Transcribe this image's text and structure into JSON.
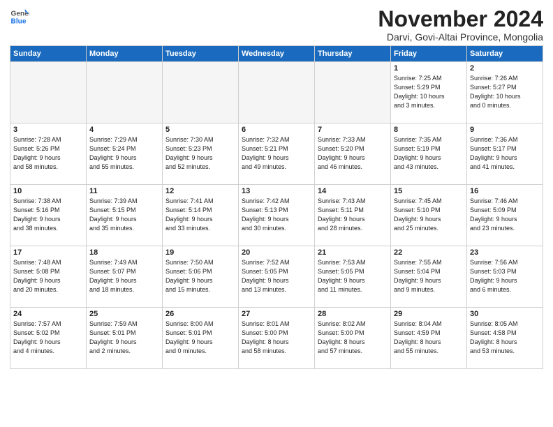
{
  "logo": {
    "line1": "General",
    "line2": "Blue"
  },
  "title": "November 2024",
  "subtitle": "Darvi, Govi-Altai Province, Mongolia",
  "weekdays": [
    "Sunday",
    "Monday",
    "Tuesday",
    "Wednesday",
    "Thursday",
    "Friday",
    "Saturday"
  ],
  "weeks": [
    [
      {
        "day": "",
        "info": "",
        "empty": true
      },
      {
        "day": "",
        "info": "",
        "empty": true
      },
      {
        "day": "",
        "info": "",
        "empty": true
      },
      {
        "day": "",
        "info": "",
        "empty": true
      },
      {
        "day": "",
        "info": "",
        "empty": true
      },
      {
        "day": "1",
        "info": "Sunrise: 7:25 AM\nSunset: 5:29 PM\nDaylight: 10 hours\nand 3 minutes.",
        "empty": false
      },
      {
        "day": "2",
        "info": "Sunrise: 7:26 AM\nSunset: 5:27 PM\nDaylight: 10 hours\nand 0 minutes.",
        "empty": false
      }
    ],
    [
      {
        "day": "3",
        "info": "Sunrise: 7:28 AM\nSunset: 5:26 PM\nDaylight: 9 hours\nand 58 minutes.",
        "empty": false
      },
      {
        "day": "4",
        "info": "Sunrise: 7:29 AM\nSunset: 5:24 PM\nDaylight: 9 hours\nand 55 minutes.",
        "empty": false
      },
      {
        "day": "5",
        "info": "Sunrise: 7:30 AM\nSunset: 5:23 PM\nDaylight: 9 hours\nand 52 minutes.",
        "empty": false
      },
      {
        "day": "6",
        "info": "Sunrise: 7:32 AM\nSunset: 5:21 PM\nDaylight: 9 hours\nand 49 minutes.",
        "empty": false
      },
      {
        "day": "7",
        "info": "Sunrise: 7:33 AM\nSunset: 5:20 PM\nDaylight: 9 hours\nand 46 minutes.",
        "empty": false
      },
      {
        "day": "8",
        "info": "Sunrise: 7:35 AM\nSunset: 5:19 PM\nDaylight: 9 hours\nand 43 minutes.",
        "empty": false
      },
      {
        "day": "9",
        "info": "Sunrise: 7:36 AM\nSunset: 5:17 PM\nDaylight: 9 hours\nand 41 minutes.",
        "empty": false
      }
    ],
    [
      {
        "day": "10",
        "info": "Sunrise: 7:38 AM\nSunset: 5:16 PM\nDaylight: 9 hours\nand 38 minutes.",
        "empty": false
      },
      {
        "day": "11",
        "info": "Sunrise: 7:39 AM\nSunset: 5:15 PM\nDaylight: 9 hours\nand 35 minutes.",
        "empty": false
      },
      {
        "day": "12",
        "info": "Sunrise: 7:41 AM\nSunset: 5:14 PM\nDaylight: 9 hours\nand 33 minutes.",
        "empty": false
      },
      {
        "day": "13",
        "info": "Sunrise: 7:42 AM\nSunset: 5:13 PM\nDaylight: 9 hours\nand 30 minutes.",
        "empty": false
      },
      {
        "day": "14",
        "info": "Sunrise: 7:43 AM\nSunset: 5:11 PM\nDaylight: 9 hours\nand 28 minutes.",
        "empty": false
      },
      {
        "day": "15",
        "info": "Sunrise: 7:45 AM\nSunset: 5:10 PM\nDaylight: 9 hours\nand 25 minutes.",
        "empty": false
      },
      {
        "day": "16",
        "info": "Sunrise: 7:46 AM\nSunset: 5:09 PM\nDaylight: 9 hours\nand 23 minutes.",
        "empty": false
      }
    ],
    [
      {
        "day": "17",
        "info": "Sunrise: 7:48 AM\nSunset: 5:08 PM\nDaylight: 9 hours\nand 20 minutes.",
        "empty": false
      },
      {
        "day": "18",
        "info": "Sunrise: 7:49 AM\nSunset: 5:07 PM\nDaylight: 9 hours\nand 18 minutes.",
        "empty": false
      },
      {
        "day": "19",
        "info": "Sunrise: 7:50 AM\nSunset: 5:06 PM\nDaylight: 9 hours\nand 15 minutes.",
        "empty": false
      },
      {
        "day": "20",
        "info": "Sunrise: 7:52 AM\nSunset: 5:05 PM\nDaylight: 9 hours\nand 13 minutes.",
        "empty": false
      },
      {
        "day": "21",
        "info": "Sunrise: 7:53 AM\nSunset: 5:05 PM\nDaylight: 9 hours\nand 11 minutes.",
        "empty": false
      },
      {
        "day": "22",
        "info": "Sunrise: 7:55 AM\nSunset: 5:04 PM\nDaylight: 9 hours\nand 9 minutes.",
        "empty": false
      },
      {
        "day": "23",
        "info": "Sunrise: 7:56 AM\nSunset: 5:03 PM\nDaylight: 9 hours\nand 6 minutes.",
        "empty": false
      }
    ],
    [
      {
        "day": "24",
        "info": "Sunrise: 7:57 AM\nSunset: 5:02 PM\nDaylight: 9 hours\nand 4 minutes.",
        "empty": false
      },
      {
        "day": "25",
        "info": "Sunrise: 7:59 AM\nSunset: 5:01 PM\nDaylight: 9 hours\nand 2 minutes.",
        "empty": false
      },
      {
        "day": "26",
        "info": "Sunrise: 8:00 AM\nSunset: 5:01 PM\nDaylight: 9 hours\nand 0 minutes.",
        "empty": false
      },
      {
        "day": "27",
        "info": "Sunrise: 8:01 AM\nSunset: 5:00 PM\nDaylight: 8 hours\nand 58 minutes.",
        "empty": false
      },
      {
        "day": "28",
        "info": "Sunrise: 8:02 AM\nSunset: 5:00 PM\nDaylight: 8 hours\nand 57 minutes.",
        "empty": false
      },
      {
        "day": "29",
        "info": "Sunrise: 8:04 AM\nSunset: 4:59 PM\nDaylight: 8 hours\nand 55 minutes.",
        "empty": false
      },
      {
        "day": "30",
        "info": "Sunrise: 8:05 AM\nSunset: 4:58 PM\nDaylight: 8 hours\nand 53 minutes.",
        "empty": false
      }
    ]
  ]
}
